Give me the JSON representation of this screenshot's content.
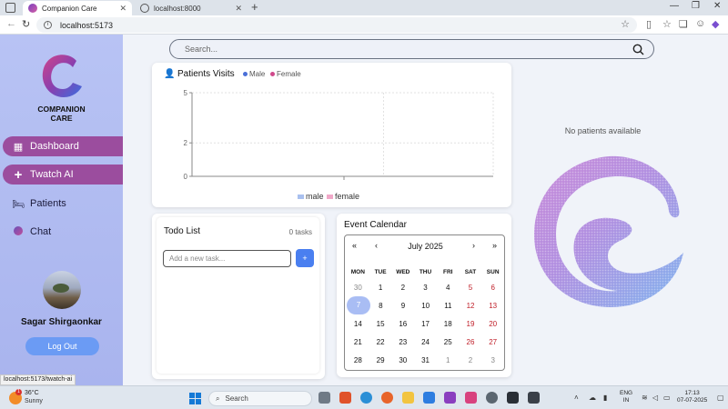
{
  "browser": {
    "tabs": [
      {
        "title": "Companion Care",
        "active": true
      },
      {
        "title": "localhost:8000",
        "active": false
      }
    ],
    "url": "localhost:5173",
    "status_url": "localhost:5173/twatch-ai"
  },
  "sidebar": {
    "brand_line1": "COMPANION",
    "brand_line2": "CARE",
    "items": [
      {
        "label": "Dashboard",
        "icon": "grid-icon",
        "active": true
      },
      {
        "label": "Twatch AI",
        "icon": "plus-icon",
        "active": true
      },
      {
        "label": "Patients",
        "icon": "bed-icon",
        "active": false
      },
      {
        "label": "Chat",
        "icon": "chat-icon",
        "active": false
      }
    ],
    "user_name": "Sagar Shirgaonkar",
    "logout_label": "Log Out"
  },
  "search": {
    "placeholder": "Search..."
  },
  "visits": {
    "title": "Patients Visits",
    "legend_top": [
      "Male",
      "Female"
    ],
    "legend_bottom": [
      "male",
      "female"
    ]
  },
  "chart_data": {
    "type": "line",
    "title": "Patients Visits",
    "y_ticks": [
      0,
      2,
      5
    ],
    "ylim": [
      0,
      5
    ],
    "series": [
      {
        "name": "male",
        "values": []
      },
      {
        "name": "female",
        "values": []
      }
    ],
    "colors": {
      "male": "#4a6fd8",
      "female": "#d04a8c"
    },
    "grid": true,
    "legend": "bottom"
  },
  "todo": {
    "title": "Todo List",
    "count": "0 tasks",
    "input_placeholder": "Add a new task...",
    "add_label": "+"
  },
  "calendar": {
    "title": "Event Calendar",
    "month": "July 2025",
    "nav": {
      "prev_year": "«",
      "prev_month": "‹",
      "next_month": "›",
      "next_year": "»"
    },
    "weekdays": [
      "MON",
      "TUE",
      "WED",
      "THU",
      "FRI",
      "SAT",
      "SUN"
    ],
    "weeks": [
      [
        "30",
        "1",
        "2",
        "3",
        "4",
        "5",
        "6"
      ],
      [
        "7",
        "8",
        "9",
        "10",
        "11",
        "12",
        "13"
      ],
      [
        "14",
        "15",
        "16",
        "17",
        "18",
        "19",
        "20"
      ],
      [
        "21",
        "22",
        "23",
        "24",
        "25",
        "26",
        "27"
      ],
      [
        "28",
        "29",
        "30",
        "31",
        "1",
        "2",
        "3"
      ]
    ]
  },
  "patients_panel": {
    "empty_text": "No patients available"
  },
  "taskbar": {
    "temp": "36°C",
    "condition": "Sunny",
    "weather_badge": "1",
    "search_label": "Search",
    "lang_line1": "ENG",
    "lang_line2": "IN",
    "time": "17:13",
    "date": "07-07-2025"
  },
  "colors": {
    "accent": "#9b4d9e",
    "sidebar": "#b3bef2",
    "button": "#6b9bf4",
    "weekend": "#c0202a"
  }
}
